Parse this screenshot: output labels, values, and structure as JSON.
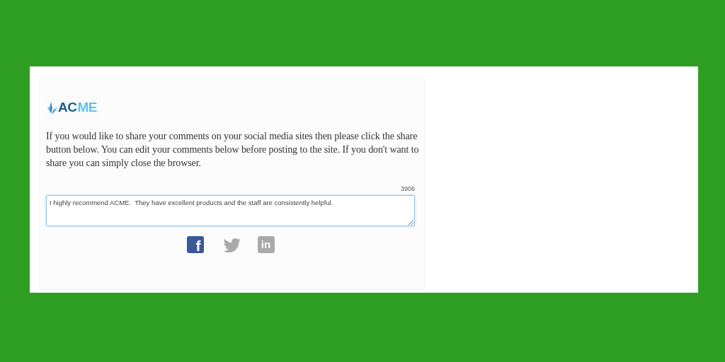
{
  "logo": {
    "parts": [
      {
        "text": "AC",
        "color": "#1d5c8c"
      },
      {
        "text": "ME",
        "color": "#5cc3ea"
      }
    ]
  },
  "message": "If you would like to share your comments on your social media sites then please click the share button below. You can edit your comments below before posting to the site. If you don't want to share you can simply close the browser.",
  "char_count": "3906",
  "comment": {
    "value": "I highly recommend ACME.  They have excellent products and the staff are consistently helpful."
  },
  "share_buttons": [
    {
      "kind": "facebook",
      "glyph": "f",
      "disabled": false
    },
    {
      "kind": "twitter",
      "disabled": true
    },
    {
      "kind": "linkedin",
      "glyph": "in",
      "disabled": true
    }
  ]
}
